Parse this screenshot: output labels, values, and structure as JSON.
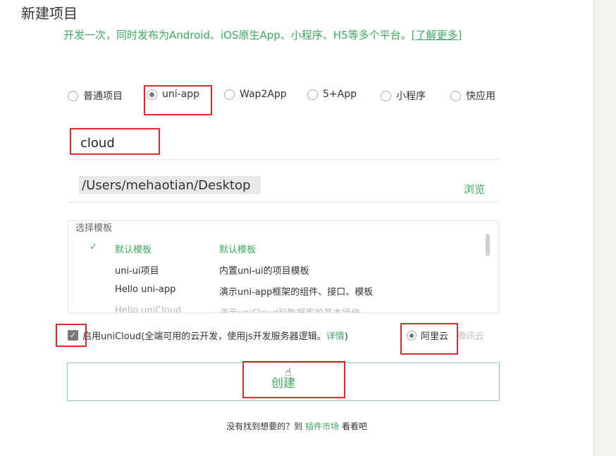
{
  "header": {
    "title": "新建项目",
    "subtitle": "开发一次，同时发布为Android、iOS原生App、小程序、H5等多个平台。",
    "learn_more": "[了解更多]"
  },
  "project_types": [
    {
      "label": "普通项目",
      "checked": false
    },
    {
      "label": "uni-app",
      "checked": true
    },
    {
      "label": "Wap2App",
      "checked": false
    },
    {
      "label": "5+App",
      "checked": false
    },
    {
      "label": "小程序",
      "checked": false
    },
    {
      "label": "快应用",
      "checked": false
    }
  ],
  "project_name": {
    "value": "cloud"
  },
  "project_path": {
    "value": "/Users/mehaotian/Desktop",
    "browse_label": "浏览"
  },
  "template": {
    "caption": "选择模板",
    "check_mark": "✓",
    "items": [
      {
        "name": "默认模板",
        "desc": "默认模板",
        "selected": true
      },
      {
        "name": "uni-ui项目",
        "desc": "内置uni-ui的项目模板",
        "selected": false
      },
      {
        "name": "Hello uni-app",
        "desc": "演示uni-app框架的组件、接口、模板",
        "selected": false
      },
      {
        "name": "Hello uniCloud",
        "desc": "演示uniCloud和数据库的基本操作",
        "selected": false
      }
    ]
  },
  "unicloud": {
    "checked": true,
    "check_mark": "✓",
    "label": "启用uniCloud(全端可用的云开发，使用js开发服务器逻辑。",
    "detail_link": "详情",
    "label_end": ")",
    "providers": [
      {
        "label": "阿里云",
        "checked": true,
        "disabled": false
      },
      {
        "label": "腾讯云",
        "checked": false,
        "disabled": true
      }
    ]
  },
  "create_button": {
    "label": "创建"
  },
  "footer": {
    "prefix": "没有找到想要的？到",
    "link": "插件市场",
    "suffix": "看看吧"
  },
  "icons": {
    "cursor": "hand-pointer-icon",
    "cursor_glyph": "☝"
  },
  "colors": {
    "accent": "#3ea85f",
    "highlight": "#e0262e"
  }
}
